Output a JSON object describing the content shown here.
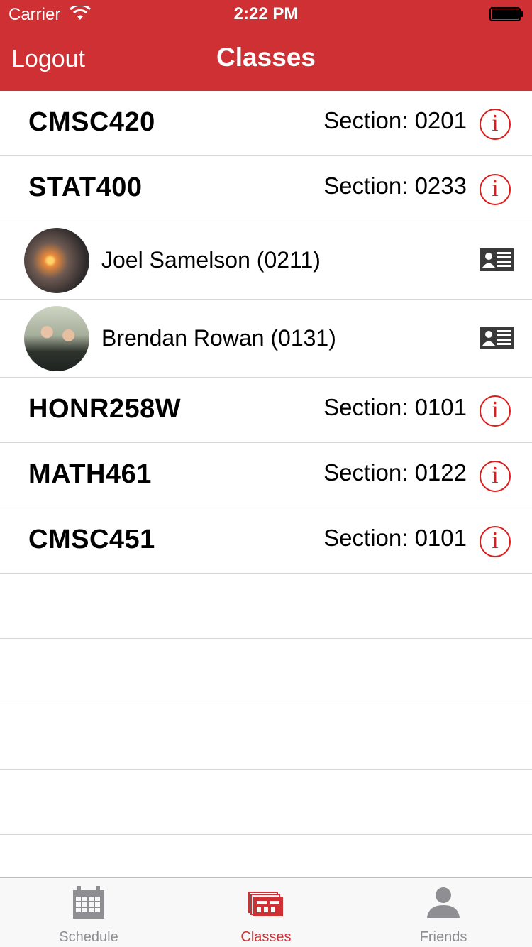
{
  "status_bar": {
    "carrier": "Carrier",
    "time": "2:22 PM"
  },
  "nav": {
    "left_button": "Logout",
    "title": "Classes"
  },
  "courses": [
    {
      "code": "CMSC420",
      "section": "Section: 0201"
    },
    {
      "code": "STAT400",
      "section": "Section: 0233"
    },
    {
      "code": "HONR258W",
      "section": "Section: 0101"
    },
    {
      "code": "MATH461",
      "section": "Section: 0122"
    },
    {
      "code": "CMSC451",
      "section": "Section: 0101"
    }
  ],
  "friends": [
    {
      "name": "Joel Samelson (0211)"
    },
    {
      "name": "Brendan Rowan (0131)"
    }
  ],
  "tabs": [
    {
      "label": "Schedule",
      "icon": "calendar-icon"
    },
    {
      "label": "Classes",
      "icon": "classes-icon"
    },
    {
      "label": "Friends",
      "icon": "person-icon"
    }
  ],
  "colors": {
    "accent": "#cf3034",
    "info": "#e01b1b",
    "inactive_tab": "#8e8e93"
  }
}
